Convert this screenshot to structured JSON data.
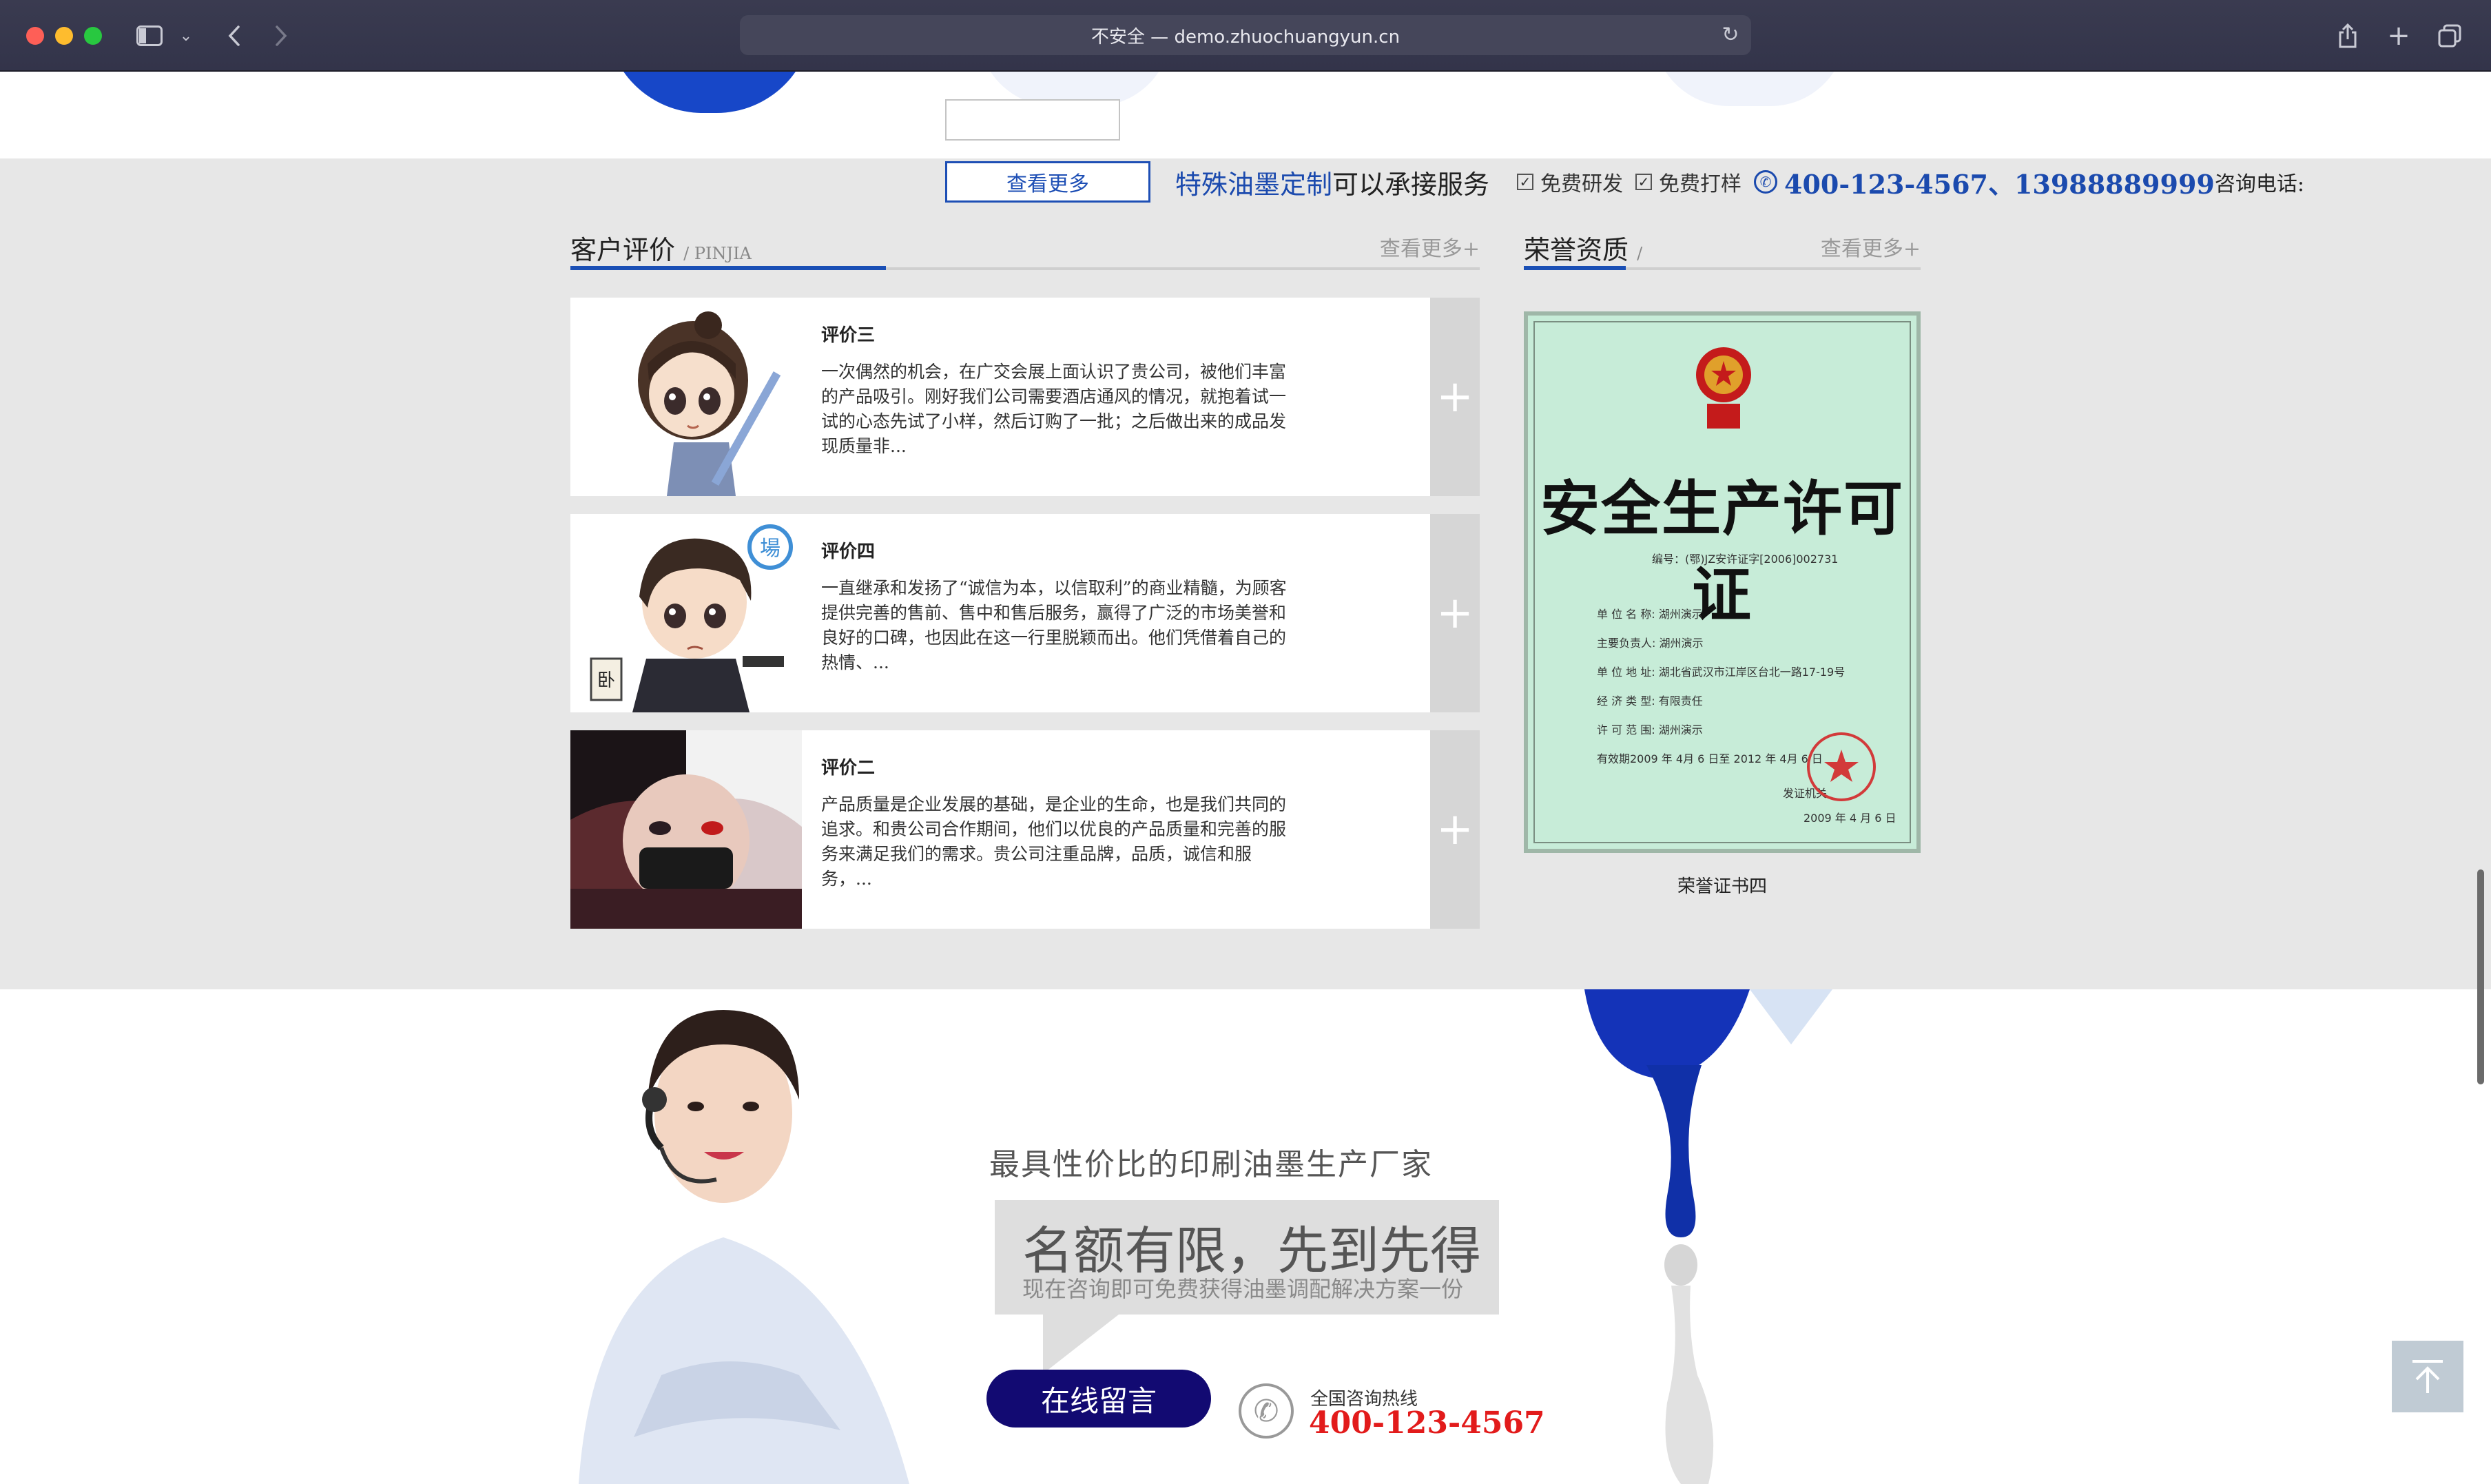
{
  "browser": {
    "url_label": "不安全 — demo.zhuochuangyun.cn"
  },
  "promo": {
    "more_button": "查看更多",
    "special_ink": "特殊油墨定制",
    "service": "可以承接服务",
    "free_rd": "免费研发",
    "free_sample": "免费打样",
    "phones": "400-123-4567、13988889999",
    "consult": "咨询电话:"
  },
  "reviews_section": {
    "title": "客户评价",
    "subtitle": "/ PINJIA",
    "more": "查看更多+",
    "items": [
      {
        "name": "评价三",
        "text": "一次偶然的机会，在广交会展上面认识了贵公司，被他们丰富的产品吸引。刚好我们公司需要酒店通风的情况，就抱着试一试的心态先试了小样，然后订购了一批；之后做出来的成品发现质量非..."
      },
      {
        "name": "评价四",
        "text": "一直继承和发扬了“诚信为本，以信取利”的商业精髓，为顾客提供完善的售前、售中和售后服务，赢得了广泛的市场美誉和良好的口碑，也因此在这一行里脱颖而出。他们凭借着自己的热情、..."
      },
      {
        "name": "评价二",
        "text": "产品质量是企业发展的基础，是企业的生命，也是我们共同的追求。和贵公司合作期间，他们以优良的产品质量和完善的服务来满足我们的需求。贵公司注重品牌，品质，诚信和服务，..."
      }
    ]
  },
  "honor_section": {
    "title": "荣誉资质",
    "subtitle": "/",
    "more": "查看更多+",
    "certificate": {
      "heading": "安全生产许可证",
      "number": "编号：(鄂)JZ安许证字[2006]002731",
      "rows": [
        "单 位 名 称:  湖州演示",
        "主要负责人:  湖州演示",
        "单 位 地 址:  湖北省武汉市江岸区台北一路17-19号",
        "经 济 类 型:  有限责任",
        "许 可 范 围:  湖州演示",
        "有效期2009 年 4月 6 日至 2012 年 4月 6 日"
      ],
      "issuer": "发证机关",
      "issue_date": "2009 年 4 月 6 日",
      "caption": "荣誉证书四"
    }
  },
  "banner": {
    "tagline": "最具性价比的印刷油墨生产厂家",
    "headline": "名额有限，先到先得",
    "subline": "现在咨询即可免费获得油墨调配解决方案一份",
    "message_button": "在线留言",
    "hotline_label": "全国咨询热线",
    "hotline_number": "400-123-4567"
  },
  "icons": {
    "back_to_top": "arrow-up-to-line-icon",
    "phone": "phone-icon"
  },
  "colors": {
    "brand_blue": "#1b4aae",
    "hotline_red": "#e21b1b",
    "button_navy": "#120a72"
  }
}
